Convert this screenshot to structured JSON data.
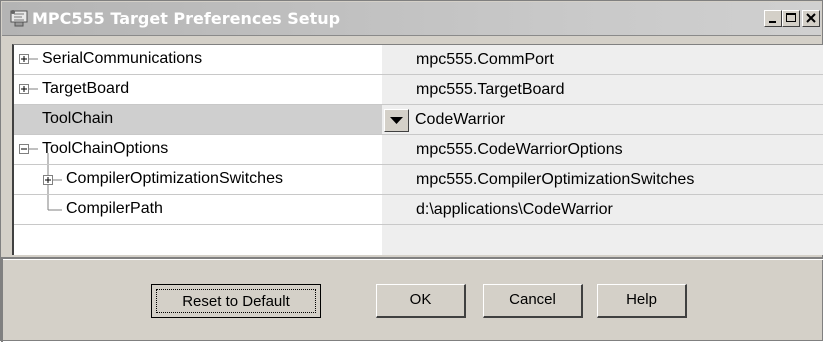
{
  "window": {
    "title": "MPC555 Target Preferences Setup",
    "icons": {
      "app": "app-icon",
      "minimize": "minimize-icon",
      "maximize": "maximize-icon",
      "close": "close-icon"
    }
  },
  "tree": {
    "rows": [
      {
        "label": "SerialCommunications",
        "value": "mpc555.CommPort",
        "expander": "plus"
      },
      {
        "label": "TargetBoard",
        "value": "mpc555.TargetBoard",
        "expander": "plus"
      },
      {
        "label": "ToolChain",
        "value": "CodeWarrior",
        "expander": "none",
        "selected": true,
        "editor": "dropdown"
      },
      {
        "label": "ToolChainOptions",
        "value": "mpc555.CodeWarriorOptions",
        "expander": "minus"
      },
      {
        "label": "CompilerOptimizationSwitches",
        "value": "mpc555.CompilerOptimizationSwitches",
        "expander": "plus"
      },
      {
        "label": "CompilerPath",
        "value": "d:\\applications\\CodeWarrior",
        "expander": "none"
      }
    ]
  },
  "buttons": {
    "reset": "Reset to Default",
    "ok": "OK",
    "cancel": "Cancel",
    "help": "Help"
  },
  "colors": {
    "selected_row": "#cfcfcf",
    "value_column": "#eeeeee",
    "dialog_bg": "#d4d0c8"
  }
}
